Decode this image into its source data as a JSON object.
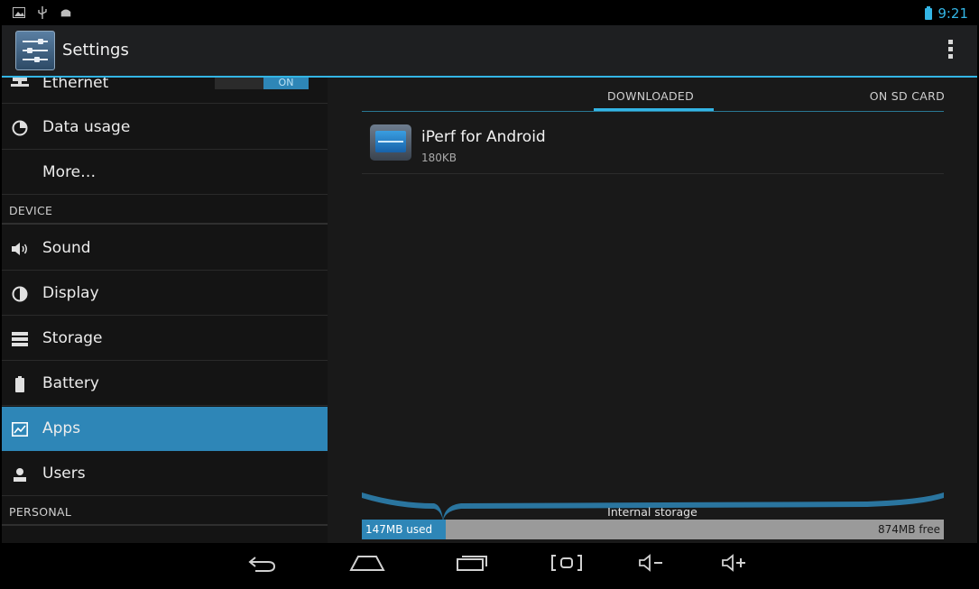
{
  "status_bar": {
    "left_icons": [
      "gallery-icon",
      "usb-icon",
      "android-debug-icon"
    ],
    "time": "9:21"
  },
  "action_bar": {
    "title": "Settings"
  },
  "sidebar": {
    "items": [
      {
        "type": "row",
        "label": "Ethernet",
        "icon": "ethernet-icon",
        "toggle": "ON"
      },
      {
        "type": "row",
        "label": "Data usage",
        "icon": "data-usage-icon"
      },
      {
        "type": "row",
        "label": "More…",
        "icon": ""
      },
      {
        "type": "section",
        "label": "DEVICE"
      },
      {
        "type": "row",
        "label": "Sound",
        "icon": "sound-icon"
      },
      {
        "type": "row",
        "label": "Display",
        "icon": "display-icon"
      },
      {
        "type": "row",
        "label": "Storage",
        "icon": "storage-icon"
      },
      {
        "type": "row",
        "label": "Battery",
        "icon": "battery-icon"
      },
      {
        "type": "row",
        "label": "Apps",
        "icon": "apps-icon",
        "selected": true
      },
      {
        "type": "row",
        "label": "Users",
        "icon": "users-icon"
      },
      {
        "type": "section",
        "label": "PERSONAL"
      }
    ]
  },
  "main": {
    "tabs": [
      {
        "label": "DOWNLOADED",
        "active": true
      },
      {
        "label": "ON SD CARD",
        "active": false
      }
    ],
    "apps": [
      {
        "name": "iPerf for Android",
        "size": "180KB"
      }
    ],
    "storage": {
      "label": "Internal storage",
      "used": "147MB used",
      "free": "874MB free",
      "used_fraction": 0.144
    }
  },
  "colors": {
    "accent": "#33b5e5",
    "selected": "#2e86b7"
  }
}
